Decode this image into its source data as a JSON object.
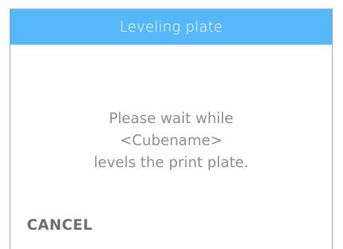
{
  "dialog": {
    "title": "Leveling plate",
    "message_lines": [
      "Please wait while",
      "<Cubename>",
      "levels the print plate."
    ],
    "cancel_label": "CANCEL"
  },
  "colors": {
    "header_background": "#56b7fb",
    "header_text": "#ffffff",
    "message_text": "#8f8f8f",
    "cancel_text": "#6e6e6e"
  }
}
